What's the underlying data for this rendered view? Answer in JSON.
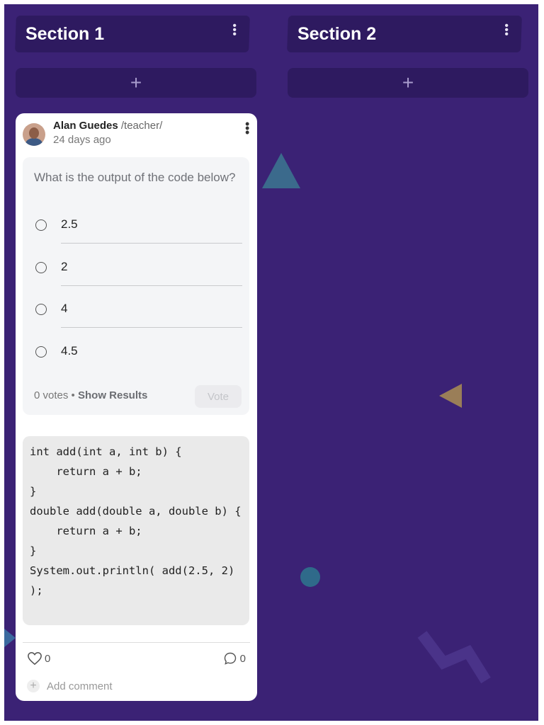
{
  "sections": [
    {
      "title": "Section 1",
      "add_label": "+"
    },
    {
      "title": "Section 2",
      "add_label": "+"
    }
  ],
  "post": {
    "author": "Alan Guedes",
    "role": "/teacher/",
    "time": "24 days ago",
    "poll": {
      "question": "What is the output of the code below?",
      "options": [
        "2.5",
        "2",
        "4",
        "4.5"
      ],
      "votes_text": "0 votes",
      "separator": "•",
      "show_results": "Show Results",
      "vote_label": "Vote"
    },
    "code": "int add(int a, int b) {\n    return a + b;\n}\ndouble add(double a, double b) {\n    return a + b;\n}\nSystem.out.println( add(2.5, 2) );",
    "likes": "0",
    "comments": "0",
    "add_comment": "Add comment"
  },
  "colors": {
    "board_bg": "#3b2275",
    "section_header_bg": "#2e1a60",
    "card_bg": "#ffffff"
  }
}
